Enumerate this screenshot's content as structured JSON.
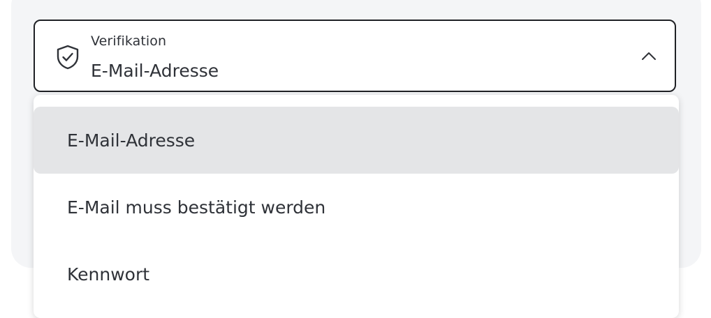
{
  "select": {
    "label": "Verifikation",
    "value": "E-Mail-Adresse",
    "icon": "shield-check-icon",
    "expanded": true
  },
  "menu": {
    "options": [
      {
        "label": "E-Mail-Adresse",
        "selected": true
      },
      {
        "label": "E-Mail muss bestätigt werden",
        "selected": false
      },
      {
        "label": "Kennwort",
        "selected": false
      }
    ]
  },
  "colors": {
    "text": "#2f3238",
    "border": "#1f2125",
    "selected_bg": "#e4e5e7",
    "panel_bg": "#f4f5f7"
  }
}
